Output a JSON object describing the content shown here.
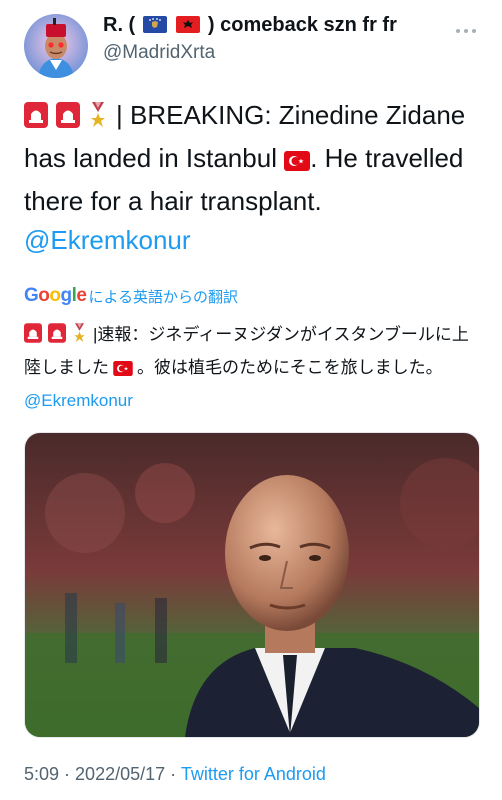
{
  "user": {
    "display_name_prefix": "R. (",
    "display_name_suffix": ") comeback szn fr fr",
    "handle": "@MadridXrta"
  },
  "tweet": {
    "text_main": "| BREAKING: Zinedine Zidane has landed in Istanbul",
    "text_tail": ". He travelled there for a hair transplant.",
    "mention": "@Ekremkonur"
  },
  "translation_bar": {
    "logo": "Google",
    "label": "による英語からの翻訳"
  },
  "translation": {
    "text_main": "|速報：ジネディーヌジダンがイスタンブールに上陸しました",
    "text_tail": "。彼は植毛のためにそこを旅しました。",
    "mention": "@Ekremkonur"
  },
  "footer": {
    "time": "5:09",
    "sep1": " · ",
    "date": "2022/05/17",
    "sep2": " · ",
    "source": "Twitter for Android"
  },
  "colors": {
    "link": "#1d9bf0",
    "secondary_text": "#536471",
    "siren_red": "#e0273a",
    "turkey_red": "#e30a17"
  },
  "icons": [
    "avatar",
    "kosovo-flag-icon",
    "albania-flag-icon",
    "more-icon",
    "siren-icon",
    "military-medal-icon",
    "turkey-flag-icon"
  ]
}
